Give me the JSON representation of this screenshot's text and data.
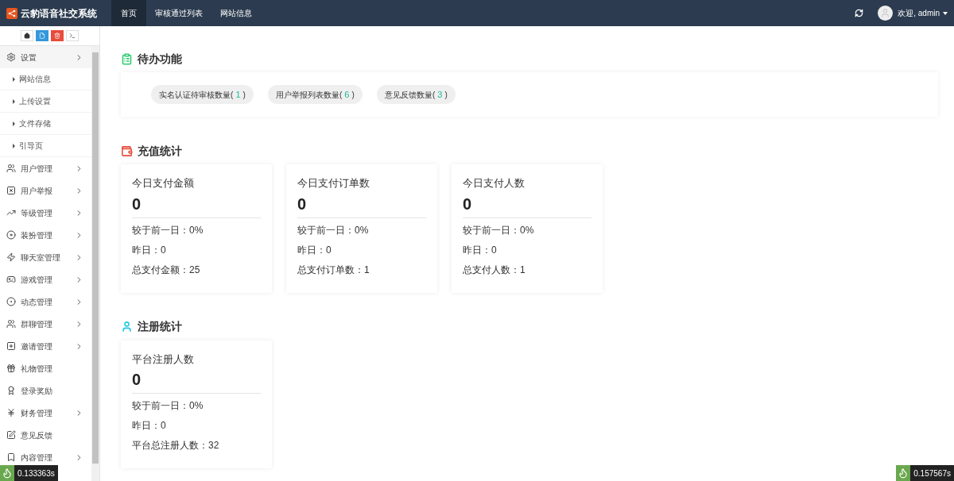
{
  "brand": {
    "title": "云豹语音社交系统"
  },
  "nav_tabs": [
    {
      "label": "首页",
      "selected": true
    },
    {
      "label": "审核通过列表",
      "selected": false
    },
    {
      "label": "网站信息",
      "selected": false
    }
  ],
  "user_menu": {
    "label": "欢迎, admin"
  },
  "sidebar": {
    "items": [
      {
        "label": "设置",
        "arrow": true,
        "expanded": true,
        "children": [
          {
            "label": "网站信息"
          },
          {
            "label": "上传设置"
          },
          {
            "label": "文件存储"
          },
          {
            "label": "引导页"
          }
        ]
      },
      {
        "label": "用户管理",
        "arrow": true,
        "expanded": false
      },
      {
        "label": "用户举报",
        "arrow": true,
        "expanded": false
      },
      {
        "label": "等级管理",
        "arrow": true,
        "expanded": false
      },
      {
        "label": "装扮管理",
        "arrow": true,
        "expanded": false
      },
      {
        "label": "聊天室管理",
        "arrow": true,
        "expanded": false
      },
      {
        "label": "游戏管理",
        "arrow": true,
        "expanded": false
      },
      {
        "label": "动态管理",
        "arrow": true,
        "expanded": false
      },
      {
        "label": "群聊管理",
        "arrow": true,
        "expanded": false
      },
      {
        "label": "邀请管理",
        "arrow": true,
        "expanded": false
      },
      {
        "label": "礼物管理",
        "arrow": false
      },
      {
        "label": "登录奖励",
        "arrow": false
      },
      {
        "label": "财务管理",
        "arrow": true,
        "expanded": false
      },
      {
        "label": "意见反馈",
        "arrow": false
      },
      {
        "label": "内容管理",
        "arrow": true,
        "expanded": false
      }
    ]
  },
  "todo": {
    "title": "待办功能",
    "pills": [
      {
        "label": "实名认证待审核数量(",
        "count": "1",
        "close": ")"
      },
      {
        "label": "用户举报列表数量(",
        "count": "6",
        "close": ")"
      },
      {
        "label": "意见反馈数量(",
        "count": "3",
        "close": ")"
      }
    ]
  },
  "recharge": {
    "title": "充值统计",
    "cards": [
      {
        "title": "今日支付金额",
        "value": "0",
        "lines": [
          "较于前一日：0%",
          "昨日：0",
          "总支付金额：25"
        ]
      },
      {
        "title": "今日支付订单数",
        "value": "0",
        "lines": [
          "较于前一日：0%",
          "昨日：0",
          "总支付订单数：1"
        ]
      },
      {
        "title": "今日支付人数",
        "value": "0",
        "lines": [
          "较于前一日：0%",
          "昨日：0",
          "总支付人数：1"
        ]
      }
    ]
  },
  "register": {
    "title": "注册统计",
    "cards": [
      {
        "title": "平台注册人数",
        "value": "0",
        "lines": [
          "较于前一日：0%",
          "昨日：0",
          "平台总注册人数：32"
        ]
      }
    ]
  },
  "debug_badges": [
    "0.133363s",
    "0.157567s"
  ]
}
